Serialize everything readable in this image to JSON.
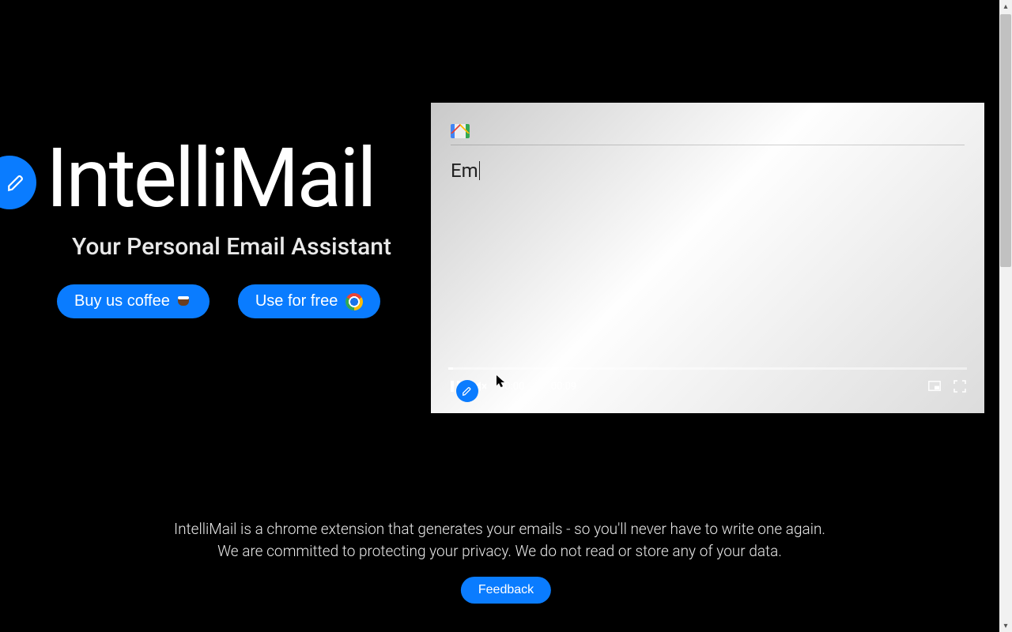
{
  "hero": {
    "title": "IntelliMail",
    "subtitle": "Your Personal Email Assistant",
    "buy_label": "Buy us coffee",
    "use_label": "Use for free"
  },
  "demo": {
    "typed_text": "Em",
    "time_current": "00:00",
    "time_total": "00:09"
  },
  "description": {
    "line1": "IntelliMail is a chrome extension that generates your emails - so you'll never have to write one again.",
    "line2": "We are committed to protecting your privacy. We do not read or store any of your data."
  },
  "feedback_label": "Feedback"
}
